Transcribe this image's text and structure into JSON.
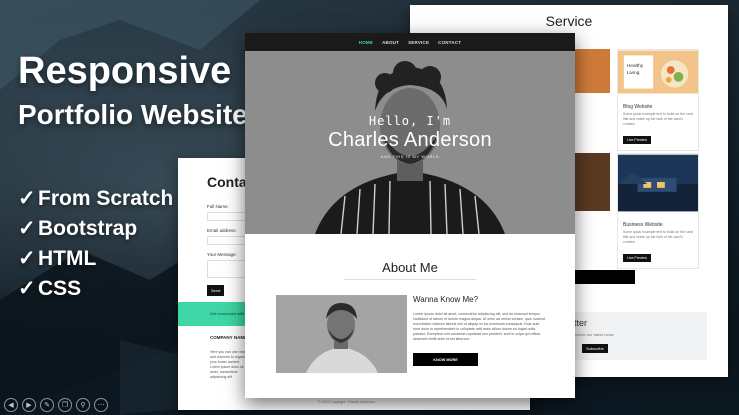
{
  "headline": {
    "line1": "Responsive",
    "line2": "Portfolio Website"
  },
  "bullets": [
    {
      "check": "✓",
      "label": "From Scratch"
    },
    {
      "check": "✓",
      "label": "Bootstrap"
    },
    {
      "check": "✓",
      "label": "HTML"
    },
    {
      "check": "✓",
      "label": "CSS"
    }
  ],
  "main": {
    "nav": [
      "HOME",
      "ABOUT",
      "SERVICE",
      "CONTACT"
    ],
    "hello": "Hello, I'm",
    "name": "Charles Anderson",
    "subtitle": "AND THIS IS MY WORLD",
    "about_title": "About Me",
    "wanna": "Wanna Know Me?",
    "about_text": "Lorem ipsum dolor sit amet, consectetur adipisicing elit, sed do eiusmod tempor incididunt ut labore et dolore magna aliqua. Ut enim ad minim veniam, quis nostrud exercitation ullamco laboris nisi ut aliquip ex ea commodo consequat. Duis aute irure dolor in reprehenderit in voluptate velit esse cillum dolore eu fugiat nulla pariatur. Excepteur sint occaecat cupidatat non proident, sunt in culpa qui officia deserunt mollit anim id est laborum.",
    "know_more": "KNOW MORE"
  },
  "service": {
    "title": "Service",
    "cards": [
      {
        "name": "Blog Website",
        "desc": "Some quick example text to build on the card title and make up the bulk of the card's content.",
        "button": "Live Preview",
        "thumb_color": "#e9a45a"
      },
      {
        "name": "Business Website",
        "desc": "Some quick example text to build on the card title and make up the bulk of the card's content.",
        "button": "Live Preview",
        "thumb_color": "#2b4a6e"
      }
    ],
    "newsletter_title": "tter",
    "newsletter_text": "eceive our latest news",
    "subscribe": "Subscribe"
  },
  "contact": {
    "title": "Conta",
    "fields": [
      {
        "label": "Full Name:"
      },
      {
        "label": "Email address:"
      },
      {
        "label": "Your Message:"
      }
    ],
    "send": "Send",
    "teal_text": "Get connected with",
    "company_name": "COMPANY NAME",
    "company_desc": "Here you can use rows and columns to organize your footer content. Lorem ipsum dolor sit amet, consectetur adipisicing elit.",
    "copyright": "© 2022 Copyright: Charles Anderson"
  },
  "toolbar": [
    "prev-icon",
    "play-icon",
    "edit-icon",
    "copy-icon",
    "zoom-icon",
    "more-icon"
  ]
}
